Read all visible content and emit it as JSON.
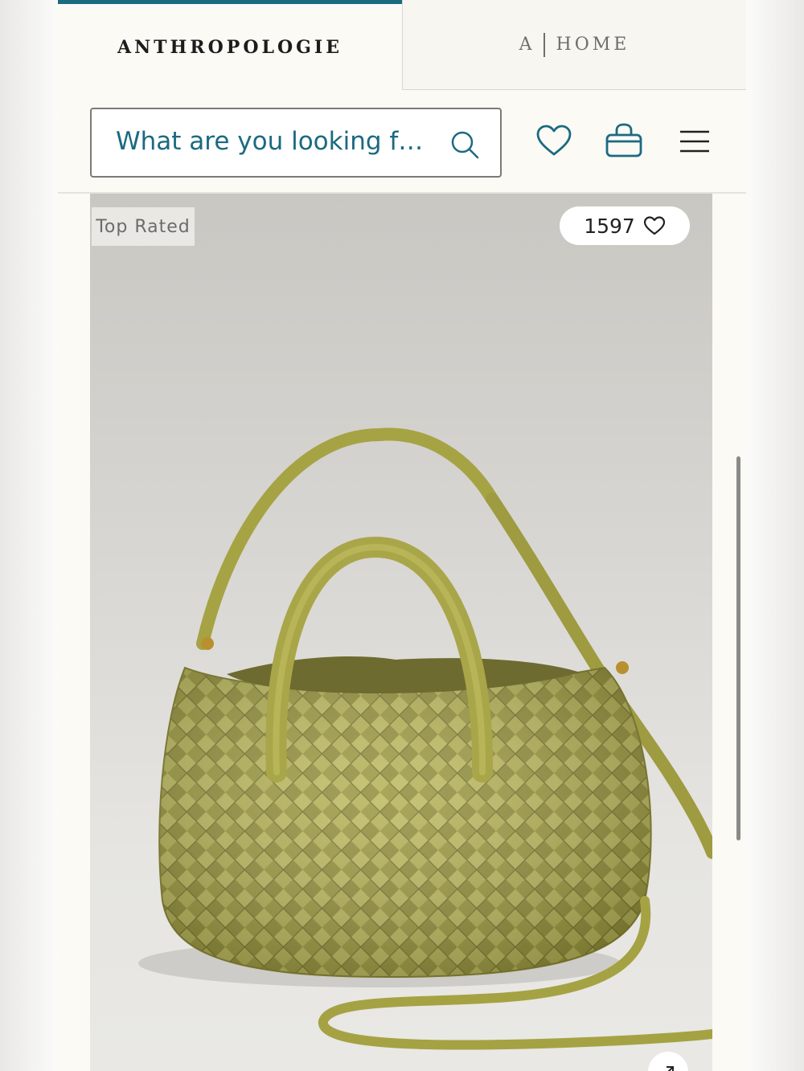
{
  "tabs": {
    "brand": "ANTHROPOLOGIE",
    "home_mark": "A",
    "home_label": "HOME"
  },
  "header": {
    "search_placeholder": "What are you looking f…"
  },
  "product": {
    "badge": "Top Rated",
    "favorites_count": "1597",
    "bag_color": "#a7a548"
  },
  "colors": {
    "accent": "#1b6a80",
    "page_bg": "#fbfaf5"
  },
  "icons": [
    "search-icon",
    "heart-icon",
    "shopping-bag-icon",
    "menu-icon",
    "expand-icon"
  ]
}
